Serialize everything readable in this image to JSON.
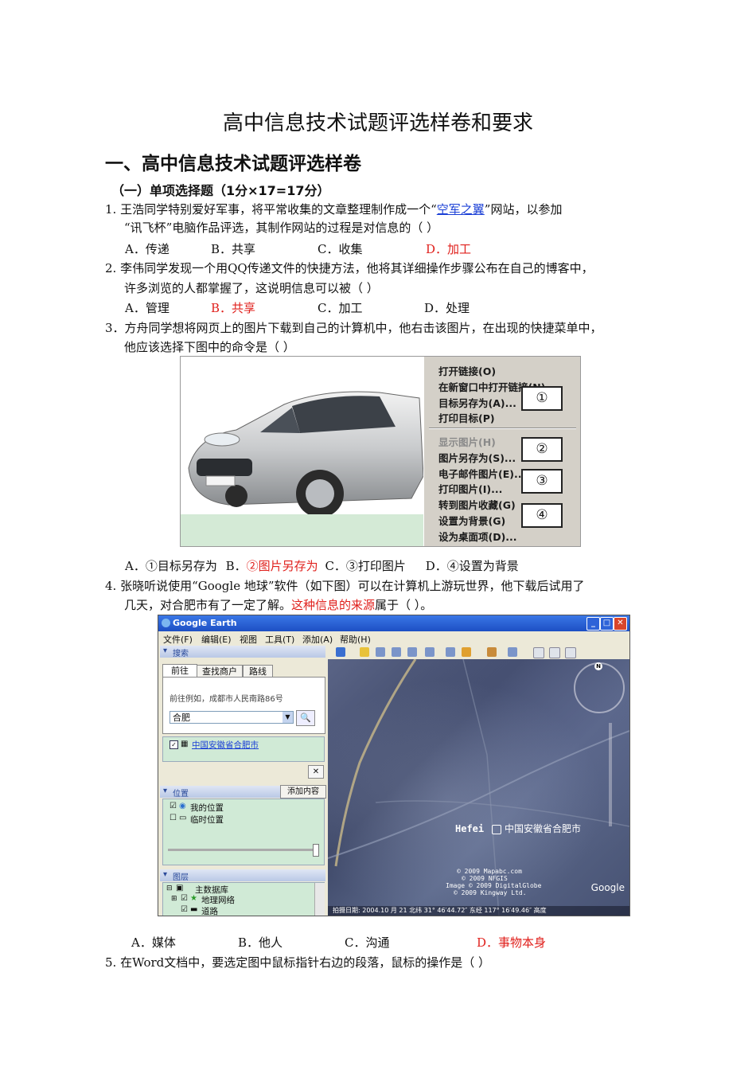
{
  "doc_title": "高中信息技术试题评选样卷和要求",
  "section_heading": "一、高中信息技术试题评选样卷",
  "subsection_heading": "（一）单项选择题（1分×17=17分）",
  "q1": {
    "line1_pre": "1.  王浩同学特别爱好军事，将平常收集的文章整理制作成一个“",
    "line1_link": "空军之翼",
    "line1_post": "”网站，以参加",
    "line2": "“讯飞杯”电脑作品评选，其制作网站的过程是对信息的（    ）",
    "opt_a": "A．传递",
    "opt_b": "B．共享",
    "opt_c": "C．收集",
    "opt_d": "D．加工"
  },
  "q2": {
    "line1": "2.  李伟同学发现一个用QQ传递文件的快捷方法，他将其详细操作步骤公布在自己的博客中，",
    "line2": "许多浏览的人都掌握了，这说明信息可以被（    ）",
    "opt_a": "A．管理",
    "opt_b": "B．共享",
    "opt_c": "C．加工",
    "opt_d": "D．处理"
  },
  "q3": {
    "line1": "3．方舟同学想将网页上的图片下载到自己的计算机中，他右击该图片，在出现的快捷菜单中，",
    "line2": "他应该选择下图中的命令是（    ）",
    "menu_items": [
      "打开链接(O)",
      "在新窗口中打开链接(N)",
      "目标另存为(A)...",
      "打印目标(P)",
      "显示图片(H)",
      "图片另存为(S)...",
      "电子邮件图片(E)...",
      "打印图片(I)...",
      "转到图片收藏(G)",
      "设置为背景(G)",
      "设为桌面项(D)..."
    ],
    "callouts": [
      "①",
      "②",
      "③",
      "④"
    ],
    "opt_a": "A．①目标另存为",
    "opt_b": "B．",
    "opt_b_answer": "②图片另存为",
    "opt_c": "C．③打印图片",
    "opt_d": "D．④设置为背景"
  },
  "q4": {
    "line1": "4.  张晓听说使用“Google 地球”软件（如下图）可以在计算机上游玩世界，他下载后试用了",
    "line2_pre": "几天，对合肥市有了一定了解。",
    "line2_red": "这种信息的来源",
    "line2_post": "属于（       ）。",
    "ge": {
      "window_title": "Google Earth",
      "menu": [
        "文件(F)",
        "编辑(E)",
        "视图",
        "工具(T)",
        "添加(A)",
        "帮助(H)"
      ],
      "search_header": "搜索",
      "tabs": [
        "前往",
        "查找商户",
        "路线"
      ],
      "goto_label": "前往例如，成都市人民南路86号",
      "search_value": "合肥",
      "result": "中国安徽省合肥市",
      "places_header": "位置",
      "add_content": "添加内容",
      "my_places": "我的位置",
      "temp_places": "临时位置",
      "layers_header": "图层",
      "layers": [
        "主数据库",
        "地理网络",
        "道路"
      ],
      "map_label_en": "Hefei",
      "map_label_cn": "中国安徽省合肥市",
      "copyright": [
        "© 2009 Mapabc.com",
        "© 2009 NFGIS",
        "Image © 2009 DigitalGlobe",
        "© 2009 Kingway Ltd."
      ],
      "status_bar": "拍摄日期: 2004.10 月 21 北纬 31° 46′44.72″ 东经 117° 16′49.46″ 高度",
      "brand": "Google"
    },
    "opt_a": "A．媒体",
    "opt_b": "B．他人",
    "opt_c": "C．沟通",
    "opt_d": "D．事物本身"
  },
  "q5": {
    "line1": "5.  在Word文档中，要选定图中鼠标指针右边的段落，鼠标的操作是（      ）"
  }
}
